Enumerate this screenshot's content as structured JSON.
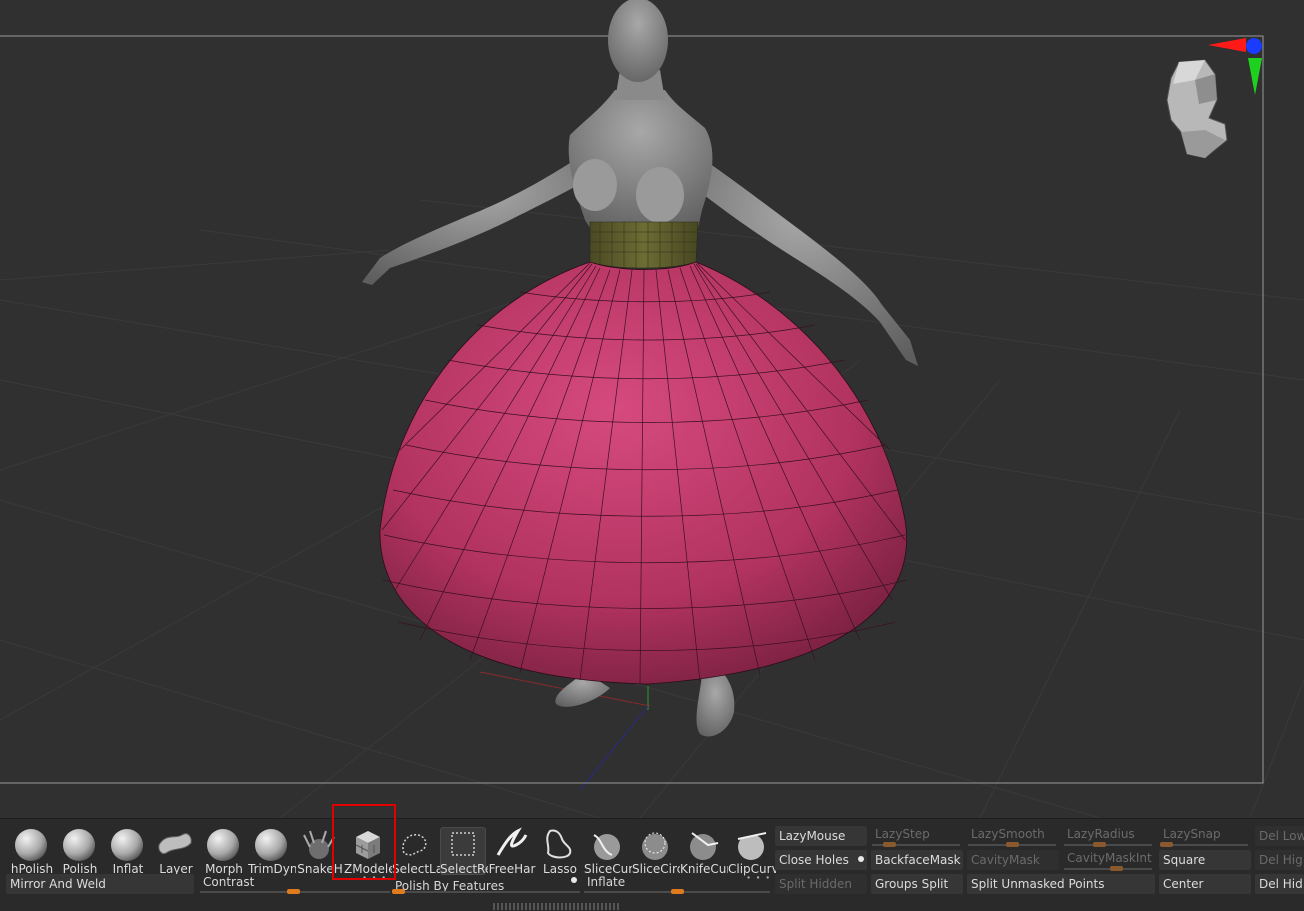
{
  "brushes": [
    {
      "id": "hpolish",
      "label": "hPolish",
      "icon": "hpolish-sphere-icon"
    },
    {
      "id": "polish",
      "label": "Polish",
      "icon": "polish-sphere-icon"
    },
    {
      "id": "inflat",
      "label": "Inflat",
      "icon": "inflat-sphere-icon"
    },
    {
      "id": "layer",
      "label": "Layer",
      "icon": "layer-brush-icon"
    },
    {
      "id": "morph",
      "label": "Morph",
      "icon": "morph-sphere-icon"
    },
    {
      "id": "trimdyn",
      "label": "TrimDyn",
      "icon": "trimdyn-sphere-icon"
    },
    {
      "id": "snakehook",
      "label": "SnakeH",
      "icon": "snakehook-brush-icon"
    },
    {
      "id": "zmodeler",
      "label": "ZModele",
      "icon": "zmodeler-cube-icon"
    },
    {
      "id": "selectlasso",
      "label": "SelectLa",
      "icon": "select-lasso-icon"
    },
    {
      "id": "selectrect",
      "label": "SelectRe",
      "icon": "select-rect-icon"
    },
    {
      "id": "freehand",
      "label": "FreeHar",
      "icon": "freehand-stroke-icon"
    },
    {
      "id": "lasso",
      "label": "Lasso",
      "icon": "lasso-icon"
    },
    {
      "id": "slicecurve",
      "label": "SliceCur",
      "icon": "slice-curve-icon"
    },
    {
      "id": "slicecirc",
      "label": "SliceCirc",
      "icon": "slice-circle-icon"
    },
    {
      "id": "knifecurve",
      "label": "KnifeCur",
      "icon": "knife-curve-icon"
    },
    {
      "id": "clipcurve",
      "label": "ClipCurv",
      "icon": "clip-curve-icon"
    }
  ],
  "row_fields": {
    "mirror_and_weld": "Mirror And Weld",
    "contrast": "Contrast",
    "polish_by_features": "Polish By Features",
    "inflate": "Inflate"
  },
  "panel": {
    "lazymouse": "LazyMouse",
    "lazystep": "LazyStep",
    "lazysmooth": "LazySmooth",
    "lazyradius": "LazyRadius",
    "lazysnap": "LazySnap",
    "del_low": "Del Low",
    "close_holes": "Close Holes",
    "backfacemask": "BackfaceMask",
    "cavitymask": "CavityMask",
    "cavitymaskint": "CavityMaskInt",
    "square": "Square",
    "del_hig": "Del Hig",
    "split_hidden": "Split Hidden",
    "groups_split": "Groups Split",
    "split_unmasked_points": "Split Unmasked Points",
    "center": "Center",
    "del_hid": "Del Hid"
  },
  "viewport": {
    "navigation_head": "navigation-head-icon",
    "axis_gizmo_colors": {
      "x": "#ff1a1a",
      "y": "#1fd11f",
      "z": "#1a3cff"
    },
    "skirt_color": "#c23a6a",
    "waistband_color": "#5a5a2c",
    "body_color": "#8c8c8c"
  },
  "highlight_target": "zmodeler",
  "active_brush": "selectrect"
}
